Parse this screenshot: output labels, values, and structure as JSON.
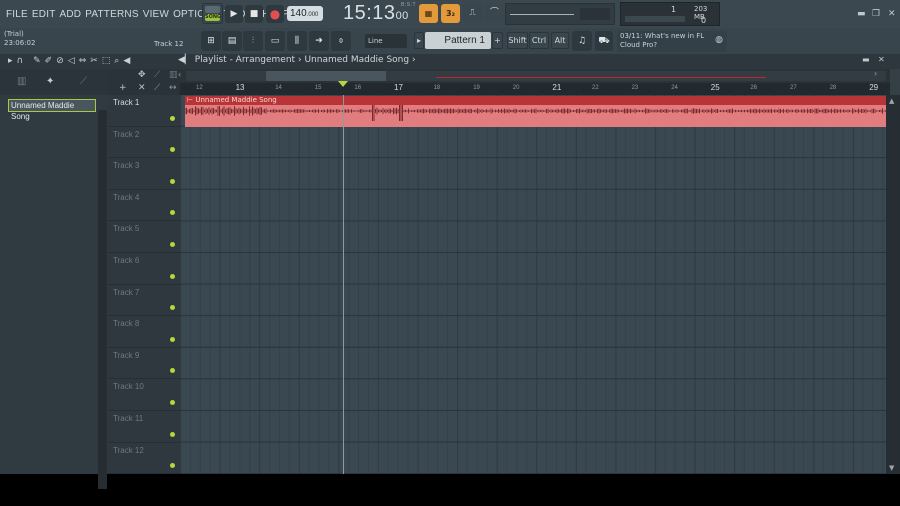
{
  "menu": [
    "FILE",
    "EDIT",
    "ADD",
    "PATTERNS",
    "VIEW",
    "OPTIONS",
    "TOOLS",
    "HELP"
  ],
  "pat_song": {
    "pat": "PAT",
    "song": "SONG"
  },
  "transport": {
    "play": "▶",
    "stop": "■",
    "record": "●"
  },
  "tempo": {
    "value": "140",
    "decimal": ".000"
  },
  "clock": {
    "main": "15:13",
    "sub": "00",
    "mode": "B:S:T"
  },
  "toolbar_buttons": [
    "▦",
    "3₂",
    "⎍",
    "⌒"
  ],
  "cpu": {
    "count": "1",
    "memory": "203 MB",
    "polyphony": "0"
  },
  "window_buttons": [
    "▬",
    "❐",
    "✕"
  ],
  "trial": {
    "label": "(Trial)",
    "time": "23:06:02"
  },
  "hint_track": "Track 12",
  "snap": {
    "label": "Line"
  },
  "pattern": {
    "label": "Pattern 1",
    "add": "+"
  },
  "modifiers": [
    "Shift",
    "Ctrl",
    "Alt"
  ],
  "news": {
    "line1": "03/11: What's new in FL",
    "line2": "Cloud Pro?"
  },
  "playlist": {
    "title": "Playlist - Arrangement",
    "sep": "›",
    "song": "Unnamed Maddie Song",
    "win_buttons": [
      "‹",
      "▬",
      "✕"
    ]
  },
  "picker": {
    "items": [
      "Unnamed Maddie Song"
    ]
  },
  "tracks": [
    "Track 1",
    "Track 2",
    "Track 3",
    "Track 4",
    "Track 5",
    "Track 6",
    "Track 7",
    "Track 8",
    "Track 9",
    "Track 10",
    "Track 11",
    "Track 12"
  ],
  "ruler": {
    "bars": [
      {
        "n": "12",
        "major": false
      },
      {
        "n": "13",
        "major": true
      },
      {
        "n": "14",
        "major": false
      },
      {
        "n": "15",
        "major": false
      },
      {
        "n": "16",
        "major": false
      },
      {
        "n": "17",
        "major": true
      },
      {
        "n": "18",
        "major": false
      },
      {
        "n": "19",
        "major": false
      },
      {
        "n": "20",
        "major": false
      },
      {
        "n": "21",
        "major": true
      },
      {
        "n": "22",
        "major": false
      },
      {
        "n": "23",
        "major": false
      },
      {
        "n": "24",
        "major": false
      },
      {
        "n": "25",
        "major": true
      },
      {
        "n": "26",
        "major": false
      },
      {
        "n": "27",
        "major": false
      },
      {
        "n": "28",
        "major": false
      },
      {
        "n": "29",
        "major": true
      }
    ]
  },
  "clip": {
    "name": "Unnamed Maddie Song"
  },
  "colors": {
    "accent": "#b6d83c",
    "clip": "#e27d7f",
    "clip_header": "#b83436",
    "orange": "#e39a3a"
  }
}
